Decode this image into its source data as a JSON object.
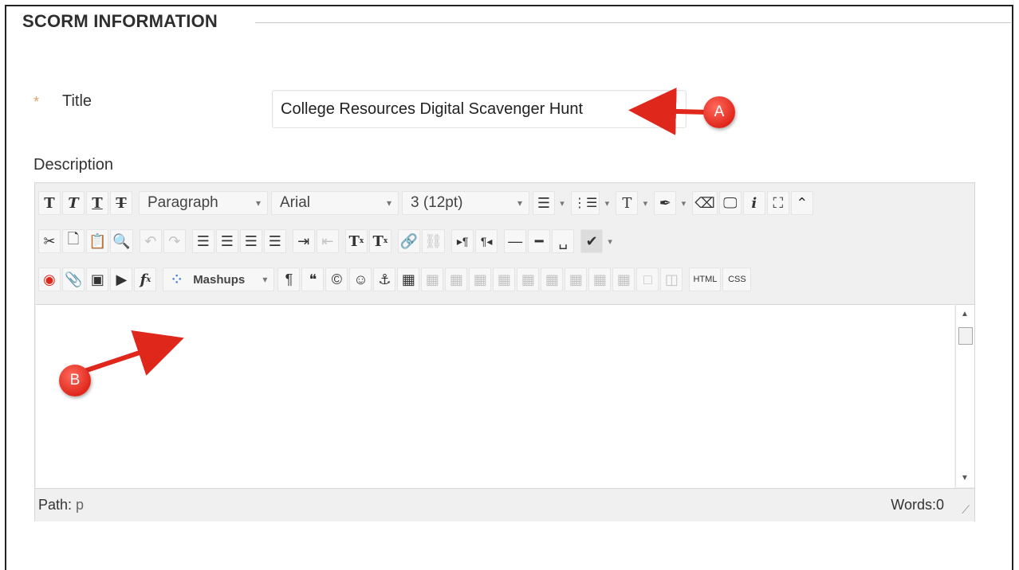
{
  "section": {
    "title": "SCORM INFORMATION"
  },
  "title_field": {
    "required_marker": "*",
    "label": "Title",
    "value": "College Resources Digital Scavenger Hunt"
  },
  "description": {
    "label": "Description"
  },
  "toolbar": {
    "format_select": "Paragraph",
    "font_select": "Arial",
    "size_select": "3 (12pt)",
    "mashups_label": "Mashups",
    "html_label": "HTML",
    "css_label": "CSS"
  },
  "status_bar": {
    "path_label": "Path:",
    "path_value": "p",
    "words_label": "Words:0"
  },
  "callouts": {
    "a": "A",
    "b": "B"
  },
  "colors": {
    "callout_red": "#e0271c",
    "required_star": "#d7a46b"
  }
}
